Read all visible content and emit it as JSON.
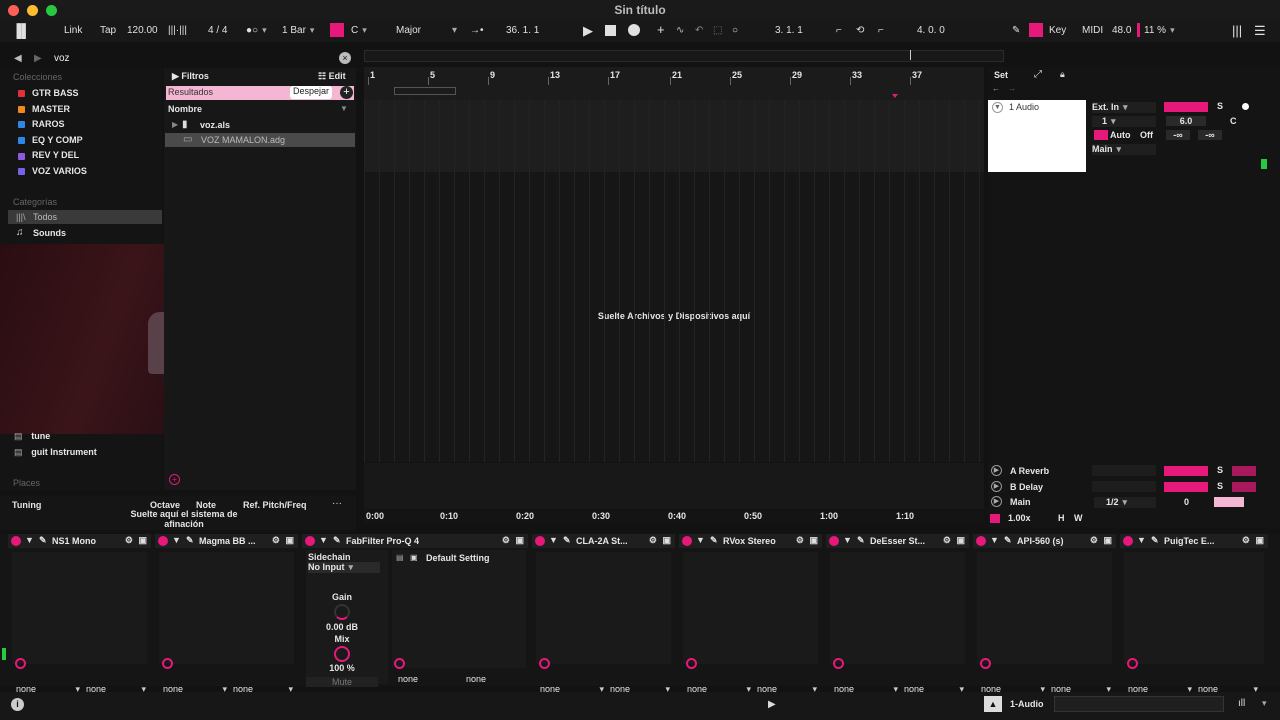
{
  "window": {
    "title": "Sin título"
  },
  "transport": {
    "link": "Link",
    "tap": "Tap",
    "tempo": "120.00",
    "meter": "4 / 4",
    "quantize": "1 Bar",
    "key": "C",
    "scale": "Major",
    "position": "36.  1.  1",
    "loop_start": "3.  1.  1",
    "loop_length": "4.  0.  0",
    "key_label": "Key",
    "midi_label": "MIDI",
    "zoom": "48.0",
    "cpu": "11 %"
  },
  "browser": {
    "search_value": "voz",
    "collections_header": "Colecciones",
    "collections": [
      {
        "label": "GTR BASS",
        "color": "#e0303a"
      },
      {
        "label": "MASTER",
        "color": "#f08a1c"
      },
      {
        "label": "RAROS",
        "color": "#2f86e6"
      },
      {
        "label": "EQ Y COMP",
        "color": "#2f86e6"
      },
      {
        "label": "REV Y DEL",
        "color": "#8e5be0"
      },
      {
        "label": "VOZ VARIOS",
        "color": "#7a5fe8"
      }
    ],
    "categories_header": "Categorías",
    "categories": [
      "Todos",
      "Sounds"
    ],
    "extra_items": [
      "tune",
      "guit Instrument"
    ],
    "places_header": "Places",
    "filters": "Filtros",
    "edit": "Edit",
    "results_label": "Resultados",
    "clear_button": "Despejar",
    "name_header": "Nombre",
    "results": [
      "voz.als",
      "VOZ MAMALON.adg"
    ],
    "tuning": {
      "title": "Tuning",
      "octave": "Octave",
      "note": "Note",
      "ref": "Ref. Pitch/Freq",
      "hint": "Suelte aquí el sistema de afinación"
    }
  },
  "arrangement": {
    "bars": [
      "1",
      "5",
      "9",
      "13",
      "17",
      "21",
      "25",
      "29",
      "33",
      "37"
    ],
    "drop_hint": "Suelte Archivos y Dispositivos aquí",
    "times": [
      "0:00",
      "0:10",
      "0:20",
      "0:30",
      "0:40",
      "0:50",
      "1:00",
      "1:10"
    ]
  },
  "mixer": {
    "set_label": "Set",
    "track_name": "1 Audio",
    "input_type": "Ext. In",
    "input_channel": "1",
    "output": "Main",
    "monitor_auto": "Auto",
    "monitor_off": "Off",
    "volume": "6.0",
    "pan": "C",
    "send_a": "-∞",
    "send_b": "-∞",
    "solo": "S",
    "returns": [
      {
        "name": "A Reverb",
        "solo": "S"
      },
      {
        "name": "B Delay",
        "solo": "S"
      }
    ],
    "main": {
      "name": "Main",
      "cue": "1/2",
      "value": "0"
    },
    "zoom": "1.00x",
    "h": "H",
    "w": "W"
  },
  "devices": [
    {
      "name": "NS1 Mono"
    },
    {
      "name": "Magma BB ..."
    },
    {
      "name": "FabFilter Pro-Q 4",
      "sidechain": "Sidechain",
      "input": "No Input",
      "preset": "Default Setting",
      "gain_label": "Gain",
      "gain": "0.00 dB",
      "mix_label": "Mix",
      "mix": "100 %",
      "mute": "Mute"
    },
    {
      "name": "CLA-2A St..."
    },
    {
      "name": "RVox Stereo"
    },
    {
      "name": "DeEsser St..."
    },
    {
      "name": "API-560 (s)"
    },
    {
      "name": "PuigTec E..."
    }
  ],
  "device_chooser": "none",
  "statusbar": {
    "track": "1-Audio"
  }
}
